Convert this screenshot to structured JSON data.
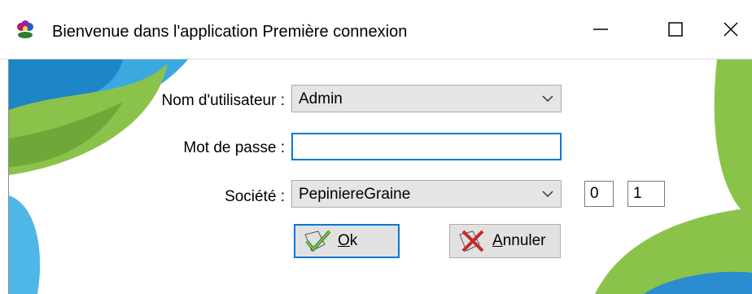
{
  "window": {
    "title": "Bienvenue dans l'application Première connexion",
    "app_icon": "flower-icon",
    "controls": {
      "minimize": "minimize-icon",
      "maximize": "maximize-icon",
      "close": "close-icon"
    }
  },
  "form": {
    "username": {
      "label": "Nom d'utilisateur :",
      "value": "Admin"
    },
    "password": {
      "label": "Mot de passe :",
      "value": ""
    },
    "company": {
      "label": "Société :",
      "value": "PepiniereGraine"
    },
    "extra_fields": [
      "0",
      "1"
    ]
  },
  "buttons": {
    "ok": {
      "label_first": "O",
      "label_rest": "k",
      "icon": "check-icon"
    },
    "cancel": {
      "label_first": "A",
      "label_rest": "nnuler",
      "icon": "cross-icon"
    }
  },
  "colors": {
    "accent": "#0078d7",
    "green": "#8bc34a",
    "blue": "#1e88c8",
    "lightblue": "#4fc3f7"
  }
}
